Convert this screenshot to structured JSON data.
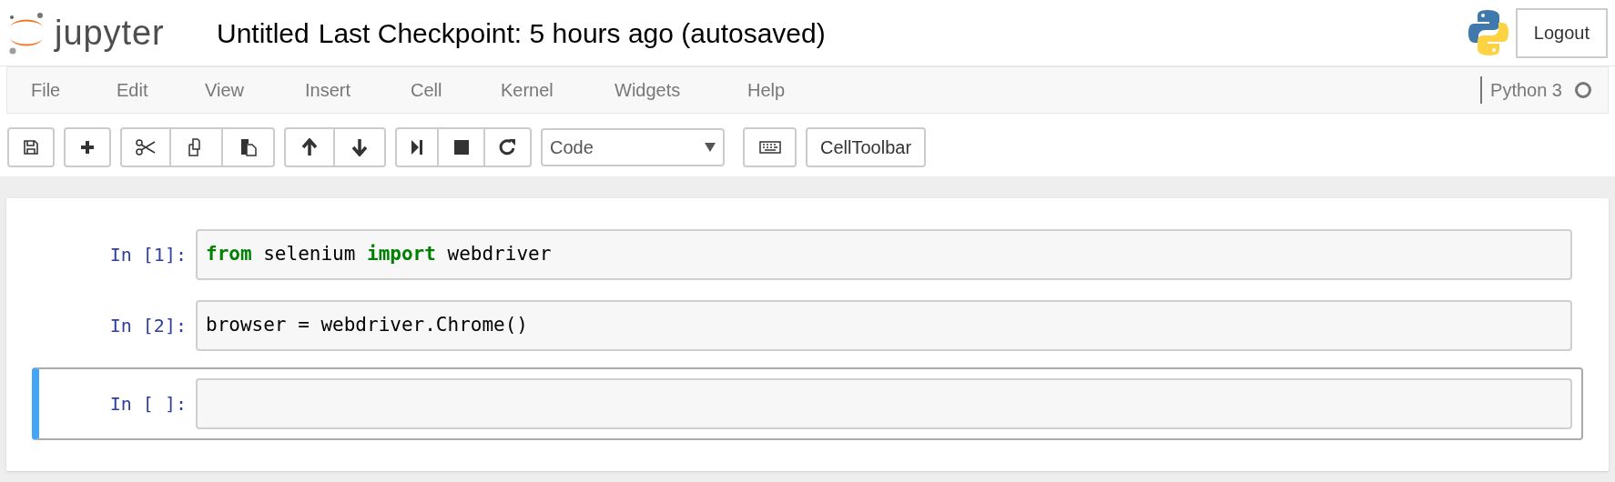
{
  "header": {
    "logo_text": "jupyter",
    "notebook_name": "Untitled",
    "checkpoint": "Last Checkpoint: 5 hours ago (autosaved)",
    "logout": "Logout"
  },
  "menu": [
    "File",
    "Edit",
    "View",
    "Insert",
    "Cell",
    "Kernel",
    "Widgets",
    "Help"
  ],
  "kernel": {
    "name": "Python 3",
    "busy": false
  },
  "toolbar": {
    "cell_type": "Code",
    "celltoolbar": "CellToolbar"
  },
  "cells": [
    {
      "prompt": "In [1]:",
      "selected": false,
      "tokens": [
        {
          "kind": "keyword",
          "text": "from"
        },
        {
          "kind": "text",
          "text": " selenium "
        },
        {
          "kind": "keyword",
          "text": "import"
        },
        {
          "kind": "text",
          "text": " webdriver"
        }
      ]
    },
    {
      "prompt": "In [2]:",
      "selected": false,
      "tokens": [
        {
          "kind": "text",
          "text": "browser = webdriver.Chrome()"
        }
      ]
    },
    {
      "prompt": "In [ ]:",
      "selected": true
    }
  ]
}
